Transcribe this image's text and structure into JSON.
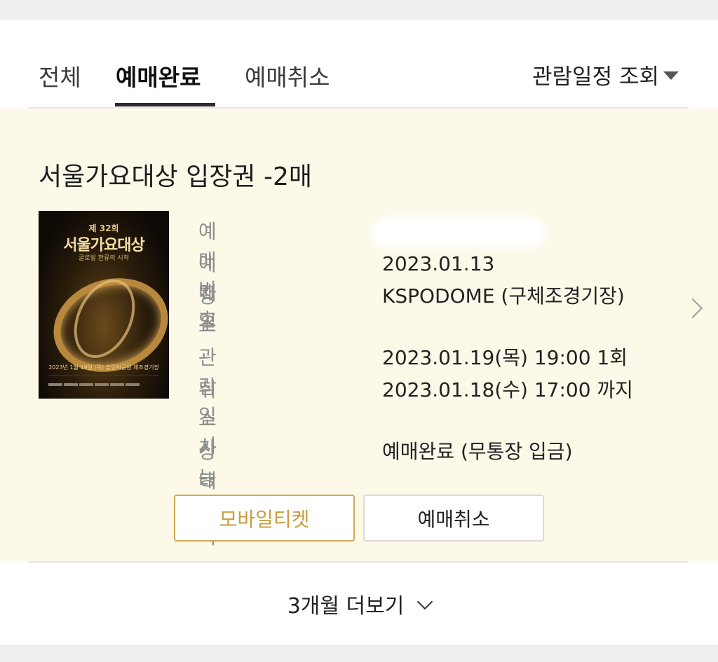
{
  "tabs": [
    {
      "label": "전체",
      "active": false
    },
    {
      "label": "예매완료",
      "active": true
    },
    {
      "label": "예매취소",
      "active": false
    }
  ],
  "schedule_filter": {
    "label": "관람일정 조회"
  },
  "booking": {
    "title": "서울가요대상 입장권 -2매",
    "poster": {
      "top": "제 32회",
      "title": "서울가요대상",
      "subtitle": "글로벌 한류의 시작",
      "date_line": "2023년 1월 19일 (목) 올림픽공원 체조경기장"
    },
    "details": [
      {
        "label": "예매번호",
        "value": ""
      },
      {
        "label": "예매일",
        "value": "2023.01.13"
      },
      {
        "label": "장소",
        "value": "KSPODOME (구체조경기장)"
      },
      {
        "label": "관람일시",
        "value": "2023.01.19(목) 19:00 1회"
      },
      {
        "label": "취소가능일시",
        "value": "2023.01.18(수) 17:00 까지"
      },
      {
        "label": "상태",
        "value": "예매완료 (무통장 입금)"
      }
    ],
    "buttons": {
      "mobile_ticket": "모바일티켓",
      "cancel": "예매취소"
    }
  },
  "more_link": {
    "label": "3개월 더보기"
  },
  "colors": {
    "accent": "#cb9b3d",
    "card_bg": "#fcf9e9"
  }
}
